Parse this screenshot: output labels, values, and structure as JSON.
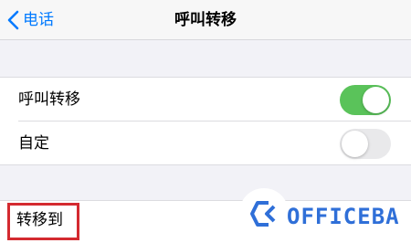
{
  "navbar": {
    "back_label": "电话",
    "title": "呼叫转移"
  },
  "settings": {
    "call_forwarding": {
      "label": "呼叫转移",
      "enabled": true
    },
    "custom": {
      "label": "自定",
      "enabled": false
    },
    "forward_to_label": "转移到"
  },
  "watermark": {
    "text": "OFFICEBA"
  },
  "colors": {
    "accent": "#007aff",
    "switch_on": "#5ac35a",
    "switch_off": "#e9e9eb",
    "highlight": "#d42a30",
    "watermark": "#2f6fd8"
  }
}
